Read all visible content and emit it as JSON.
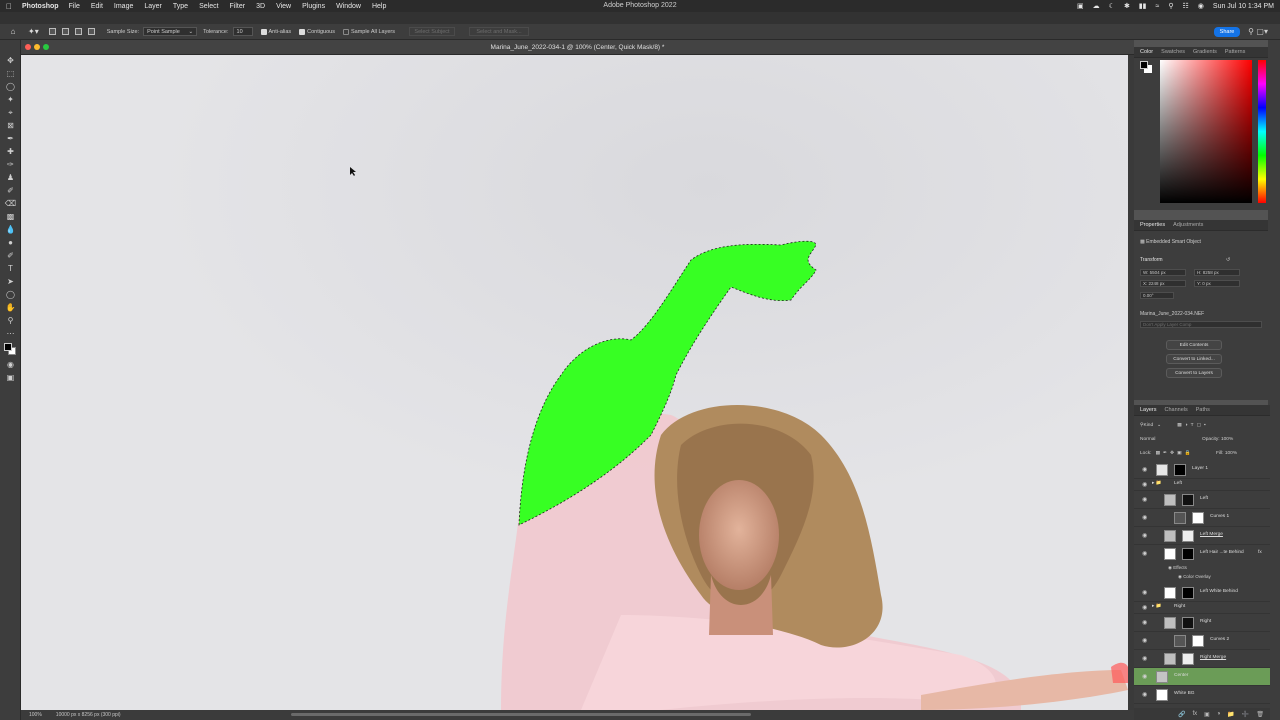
{
  "menubar": {
    "app_name": "Photoshop",
    "items": [
      "File",
      "Edit",
      "Image",
      "Layer",
      "Type",
      "Select",
      "Filter",
      "3D",
      "View",
      "Plugins",
      "Window",
      "Help"
    ],
    "window_title": "Adobe Photoshop 2022",
    "clock": "Sun Jul 10  1:34 PM"
  },
  "options_bar": {
    "sample_size_label": "Sample Size:",
    "sample_size_value": "Point Sample",
    "tolerance_label": "Tolerance:",
    "tolerance_value": "10",
    "anti_alias_label": "Anti-alias",
    "contiguous_label": "Contiguous",
    "sample_all_layers_label": "Sample All Layers",
    "select_subject_label": "Select Subject",
    "select_and_mask_label": "Select and Mask...",
    "share_label": "Share"
  },
  "document": {
    "title": "Marina_June_2022-034-1 @ 100% (Center, Quick Mask/8) *",
    "zoom": "100%",
    "doc_info": "10000 px x 8256 px (300 ppi)"
  },
  "color_panel": {
    "tabs": [
      "Color",
      "Swatches",
      "Gradients",
      "Patterns"
    ]
  },
  "properties_panel": {
    "tabs": [
      "Properties",
      "Adjustments"
    ],
    "kind": "Embedded Smart Object",
    "transform_label": "Transform",
    "w": "W: 5504 px",
    "h": "H: 8258 px",
    "x": "X: 2248 px",
    "y": "Y: 0 px",
    "angle": "0.00°",
    "file_name": "Marina_June_2022-034.NEF",
    "layer_comp": "Don't Apply Layer Comp",
    "btn_edit": "Edit Contents",
    "btn_convert_linked": "Convert to Linked...",
    "btn_convert_layers": "Convert to Layers"
  },
  "layers_panel": {
    "tabs": [
      "Layers",
      "Channels",
      "Paths"
    ],
    "kind_filter": "Kind",
    "blend_mode": "Normal",
    "opacity_label": "Opacity:",
    "opacity_value": "100%",
    "lock_label": "Lock:",
    "fill_label": "Fill:",
    "fill_value": "100%",
    "layers": [
      {
        "name": "Layer 1"
      },
      {
        "name": "Left"
      },
      {
        "name": "Left"
      },
      {
        "name": "Curves 1"
      },
      {
        "name": "Left Merge"
      },
      {
        "name": "Left Hair ...te Behind"
      },
      {
        "name": "Effects"
      },
      {
        "name": "Color Overlay"
      },
      {
        "name": "Left White Behind"
      },
      {
        "name": "Right"
      },
      {
        "name": "Right"
      },
      {
        "name": "Curves 2"
      },
      {
        "name": "Right Merge"
      },
      {
        "name": "Center"
      },
      {
        "name": "White BG"
      }
    ],
    "fx_label": "fx"
  },
  "colors": {
    "accent_green_mask": "#37ff23",
    "share_blue": "#1473e6",
    "selected_layer": "#6b9c57"
  }
}
